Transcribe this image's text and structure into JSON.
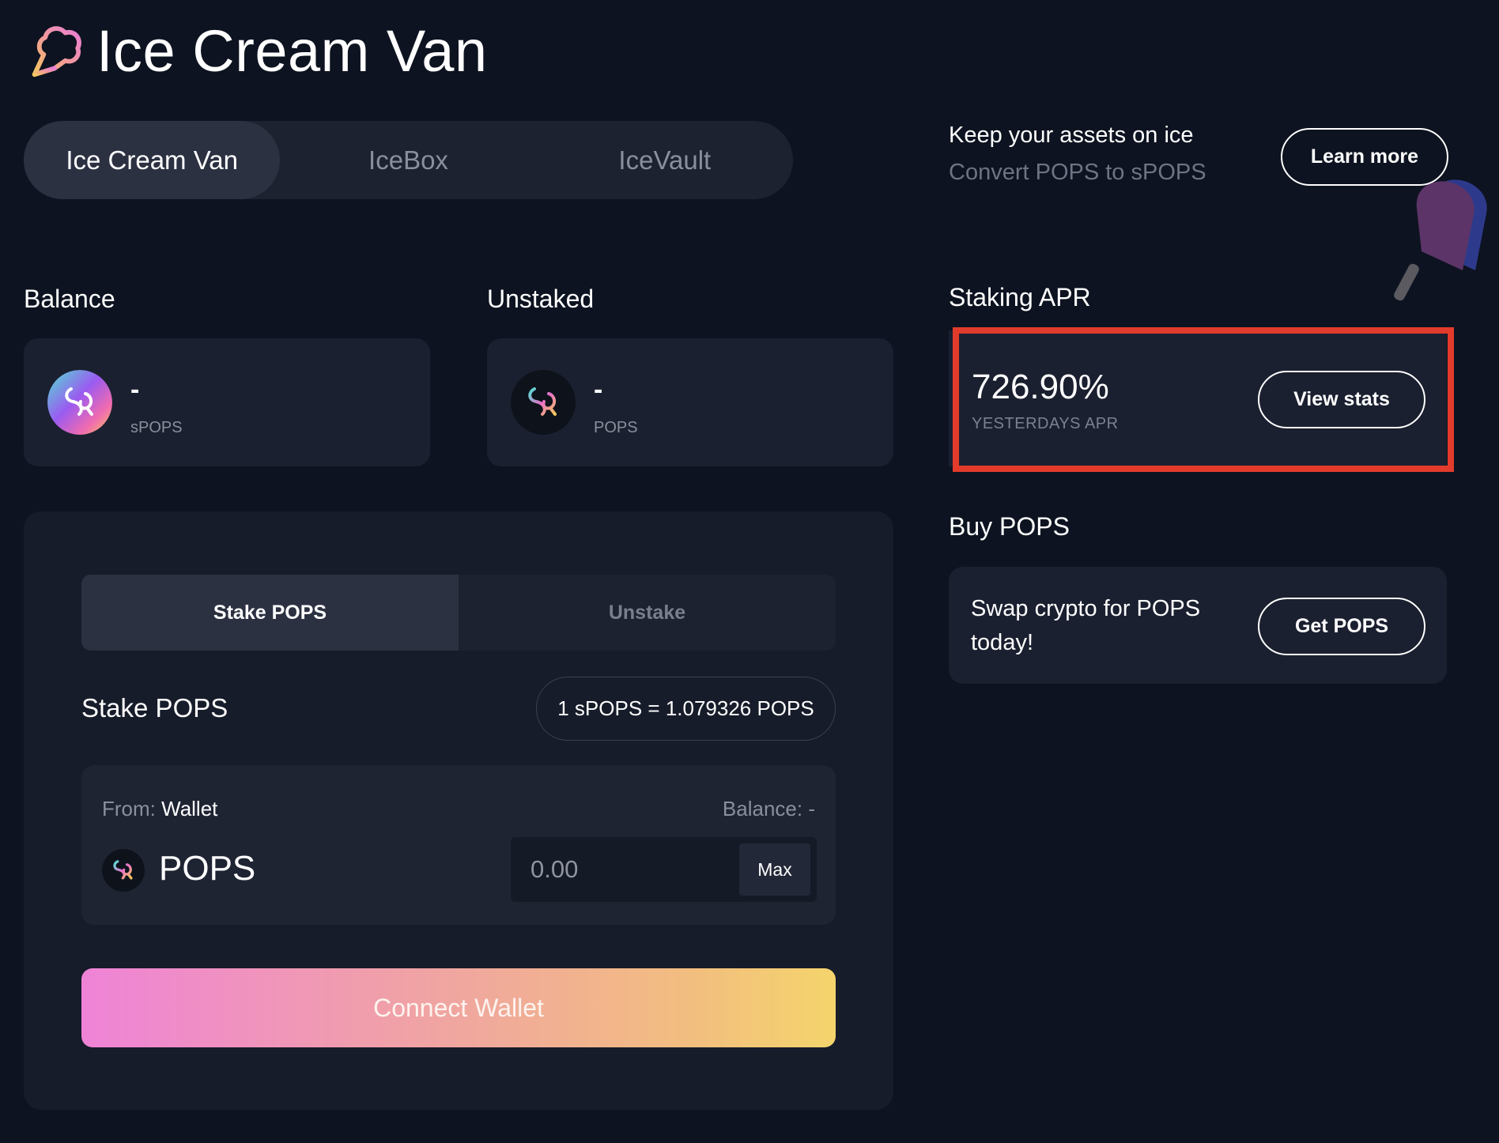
{
  "app": {
    "title": "Ice Cream Van"
  },
  "nav": {
    "tabs": [
      {
        "label": "Ice Cream Van",
        "active": true
      },
      {
        "label": "IceBox",
        "active": false
      },
      {
        "label": "IceVault",
        "active": false
      }
    ]
  },
  "promo": {
    "title": "Keep your assets on ice",
    "subtitle": "Convert POPS to sPOPS",
    "button_label": "Learn more"
  },
  "balance": {
    "label": "Balance",
    "value": "-",
    "unit": "sPOPS"
  },
  "unstaked": {
    "label": "Unstaked",
    "value": "-",
    "unit": "POPS"
  },
  "apr": {
    "label": "Staking APR",
    "value": "726.90%",
    "sublabel": "YESTERDAYS APR",
    "button_label": "View stats",
    "highlight_color": "#e23b2c"
  },
  "buy": {
    "label": "Buy POPS",
    "text": "Swap crypto for POPS today!",
    "button_label": "Get POPS"
  },
  "stake": {
    "modes": [
      {
        "label": "Stake POPS",
        "active": true
      },
      {
        "label": "Unstake",
        "active": false
      }
    ],
    "title": "Stake POPS",
    "rate": "1 sPOPS = 1.079326 POPS",
    "from_prefix": "From:",
    "from_source": "Wallet",
    "balance_text": "Balance: -",
    "token": "POPS",
    "amount_placeholder": "0.00",
    "max_label": "Max",
    "connect_label": "Connect Wallet"
  },
  "icons": {
    "logo": "ice-cream-logo-icon",
    "spops": "spops-token-icon",
    "pops": "pops-token-icon",
    "popsicle": "popsicle-icon"
  },
  "colors": {
    "background": "#0d1320",
    "card": "#1b2030",
    "gradient_start": "#ef83d7",
    "gradient_end": "#f4d46c"
  }
}
